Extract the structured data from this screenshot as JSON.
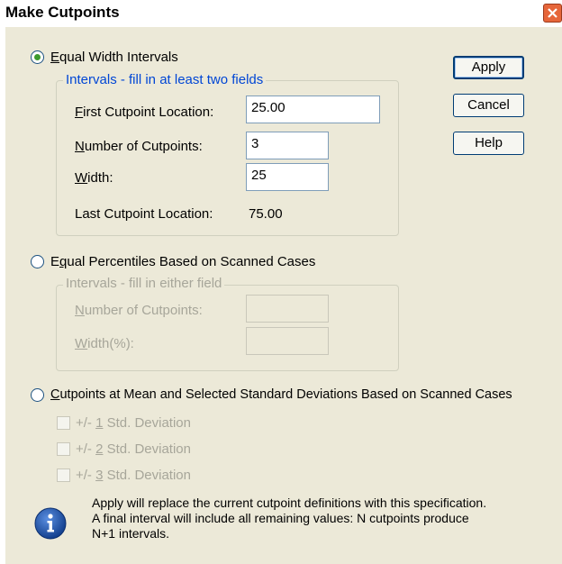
{
  "window": {
    "title": "Make Cutpoints"
  },
  "equal_width": {
    "label_prefix": "",
    "label_key": "E",
    "label_rest": "qual Width Intervals",
    "selected": true,
    "group_title": "Intervals - fill in at least two fields",
    "first_label_key": "F",
    "first_label_rest": "irst Cutpoint Location:",
    "first_value": "25.00",
    "number_label_key": "N",
    "number_label_rest": "umber of Cutpoints:",
    "number_value": "3",
    "width_label_key": "W",
    "width_label_rest": "idth:",
    "width_value": "25",
    "last_label": "Last Cutpoint Location:",
    "last_value": "75.00"
  },
  "equal_percentiles": {
    "label_prefix": "E",
    "label_key": "q",
    "label_rest": "ual Percentiles Based on Scanned Cases",
    "selected": false,
    "group_title": "Intervals - fill in either field",
    "number_label_key": "N",
    "number_label_rest": "umber of Cutpoints:",
    "width_label_key": "W",
    "width_label_rest": "idth(%):",
    "number_value": "",
    "width_value": ""
  },
  "mean_sd": {
    "label_key": "C",
    "label_rest": "utpoints at Mean and Selected Standard Deviations Based on Scanned Cases",
    "selected": false,
    "options": [
      {
        "prefix": "+/- ",
        "key": "1",
        "rest": " Std. Deviation"
      },
      {
        "prefix": "+/- ",
        "key": "2",
        "rest": " Std. Deviation"
      },
      {
        "prefix": "+/- ",
        "key": "3",
        "rest": " Std. Deviation"
      }
    ]
  },
  "buttons": {
    "apply": "Apply",
    "cancel": "Cancel",
    "help": "Help"
  },
  "info": {
    "line1": "Apply will replace the current cutpoint definitions with this specification.",
    "line2": "A final interval will include all remaining values: N cutpoints produce",
    "line3": "N+1 intervals."
  },
  "colors": {
    "group_title": "#0046d5",
    "radio_dot": "#3d9a2e",
    "info_icon": "#1a4ea8"
  },
  "icons": {
    "close": "close-icon",
    "info": "info-icon"
  }
}
